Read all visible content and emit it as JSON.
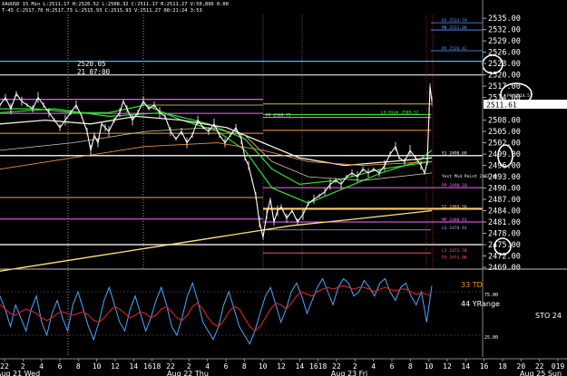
{
  "header": {
    "line1": "XAUUSD  15 Min  L:2511.17  H:2526.52  L:2508.32  C:2511.17  R:2511.27  V:50,896  0.00",
    "line2": "T-45  C:2517.70  H:2517.73  L:2515.93  C:2515.93  V:2511.27  08:21:24  3:53"
  },
  "tooltip": {
    "value": "2520.05",
    "time": "21 07:00"
  },
  "last_price": "2511.61",
  "main_chart": {
    "type": "line",
    "y_ticks": [
      "2535.00",
      "2532.00",
      "2529.00",
      "2526.00",
      "2523.00",
      "2520.00",
      "2517.00",
      "2514.00",
      "2511.61",
      "2508.00",
      "2505.00",
      "2502.00",
      "2499.00",
      "2496.00",
      "2493.00",
      "2490.00",
      "2487.00",
      "2484.00",
      "2481.00",
      "2478.00",
      "2475.00",
      "2472.00",
      "2469.00"
    ],
    "ylim": [
      2469,
      2536
    ],
    "level_labels": [
      {
        "text": "R2 2533.79",
        "value": 2533.8,
        "color": "#5a9bff"
      },
      {
        "text": "MB 2531.88",
        "value": 2531.9,
        "color": "#5a9bff"
      },
      {
        "text": "R5 2526.42",
        "value": 2526.4,
        "color": "#5a9bff"
      },
      {
        "text": "LH High 2509.52",
        "value": 2509.5,
        "color": "#33ff33"
      },
      {
        "text": "PP 2508.75",
        "value": 2508.7,
        "color": "#ffb0ff"
      },
      {
        "text": "S1 2498.69",
        "value": 2498.6,
        "color": "#ffffff"
      },
      {
        "text": "Yest Mid Point 2492.48",
        "value": 2492.5,
        "color": "#ffffff"
      },
      {
        "text": "PP 2490.10",
        "value": 2490.1,
        "color": "#ff66ff"
      },
      {
        "text": "S2 2484.56",
        "value": 2484.5,
        "color": "#ffd060"
      },
      {
        "text": "MP 2480.91",
        "value": 2481.0,
        "color": "#ff66ff"
      },
      {
        "text": "LG 2478.91",
        "value": 2478.9,
        "color": "#aaaaff"
      },
      {
        "text": "L3 2472.78",
        "value": 2472.8,
        "color": "#ff6666"
      },
      {
        "text": "P3 2471.06",
        "value": 2471.1,
        "color": "#ff6666"
      }
    ],
    "right_label": "PH 2514.57"
  },
  "oscillator": {
    "label1": "33 TD",
    "label2": "44 YRange",
    "sto_label": "STO  24",
    "tick_75": "75.00",
    "tick_25": "25.00"
  },
  "x_axis": {
    "ticks": [
      "22",
      "2",
      "4",
      "6",
      "8",
      "10",
      "12",
      "14",
      "1618",
      "22",
      "2",
      "4",
      "6",
      "8",
      "10",
      "12",
      "14",
      "1618",
      "22",
      "2",
      "4",
      "6",
      "8",
      "10",
      "12",
      "14",
      "16",
      "18",
      "20",
      "22",
      "019"
    ],
    "dates": [
      "Aug 21 Wed",
      "Aug 22 Thu",
      "Aug 23 Fri",
      "Aug 25 Sun"
    ]
  },
  "colors": {
    "background": "#000000",
    "price": "#ffffff",
    "ma_green": "#33dd33",
    "ma_white": "#f0f0e0",
    "ma_yellow": "#ffe27a",
    "ma_orange": "#e89040",
    "osc_blue": "#4aa8ff",
    "osc_red": "#e02020"
  }
}
